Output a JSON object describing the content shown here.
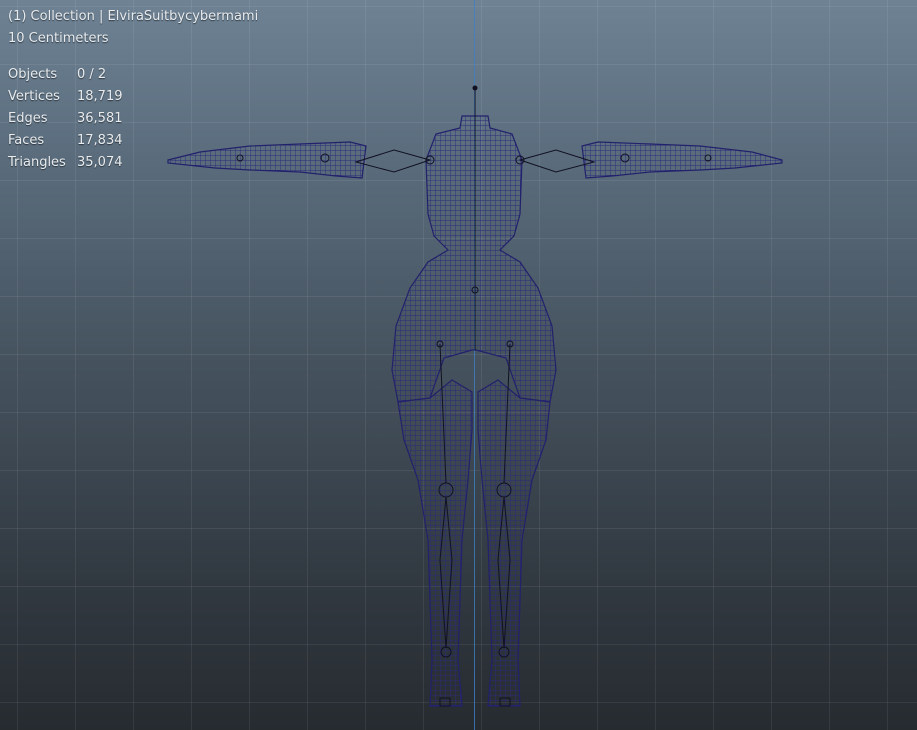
{
  "viewport": {
    "collection_line": "(1) Collection | ElviraSuitbycybermami",
    "units_line": "10 Centimeters",
    "stats": [
      {
        "label": "Objects",
        "value": "0 / 2"
      },
      {
        "label": "Vertices",
        "value": "18,719"
      },
      {
        "label": "Edges",
        "value": "36,581"
      },
      {
        "label": "Faces",
        "value": "17,834"
      },
      {
        "label": "Triangles",
        "value": "35,074"
      }
    ],
    "colors": {
      "wireframe": "#2b2a7a",
      "armature": "#111122",
      "axis": "#3f7fc4"
    }
  }
}
